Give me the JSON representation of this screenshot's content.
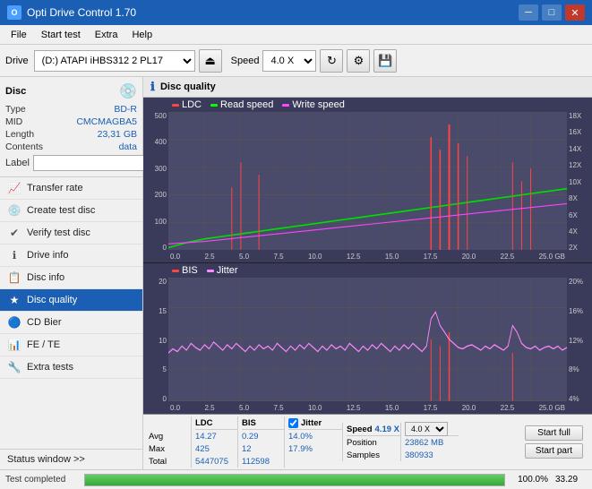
{
  "titlebar": {
    "title": "Opti Drive Control 1.70",
    "icon": "O",
    "min_label": "─",
    "max_label": "□",
    "close_label": "✕"
  },
  "menubar": {
    "items": [
      "File",
      "Start test",
      "Extra",
      "Help"
    ]
  },
  "toolbar": {
    "drive_label": "Drive",
    "drive_value": "(D:) ATAPI iHBS312  2 PL17",
    "speed_label": "Speed",
    "speed_value": "4.0 X"
  },
  "disc": {
    "title": "Disc",
    "type_label": "Type",
    "type_value": "BD-R",
    "mid_label": "MID",
    "mid_value": "CMCMAGBA5",
    "length_label": "Length",
    "length_value": "23,31 GB",
    "contents_label": "Contents",
    "contents_value": "data",
    "label_label": "Label",
    "label_placeholder": ""
  },
  "nav": {
    "items": [
      {
        "id": "transfer-rate",
        "label": "Transfer rate",
        "icon": "📈"
      },
      {
        "id": "create-test-disc",
        "label": "Create test disc",
        "icon": "💿"
      },
      {
        "id": "verify-test-disc",
        "label": "Verify test disc",
        "icon": "✔"
      },
      {
        "id": "drive-info",
        "label": "Drive info",
        "icon": "ℹ"
      },
      {
        "id": "disc-info",
        "label": "Disc info",
        "icon": "📋"
      },
      {
        "id": "disc-quality",
        "label": "Disc quality",
        "icon": "★",
        "active": true
      },
      {
        "id": "cd-bier",
        "label": "CD Bier",
        "icon": "🔵"
      },
      {
        "id": "fe-te",
        "label": "FE / TE",
        "icon": "📊"
      },
      {
        "id": "extra-tests",
        "label": "Extra tests",
        "icon": "🔧"
      }
    ],
    "status_window": "Status window >>"
  },
  "chart1": {
    "title": "Disc quality",
    "legend": [
      {
        "label": "LDC",
        "color": "#ff4444"
      },
      {
        "label": "Read speed",
        "color": "#00ff00"
      },
      {
        "label": "Write speed",
        "color": "#ff44ff"
      }
    ],
    "y_left": [
      "500",
      "400",
      "300",
      "200",
      "100",
      "0"
    ],
    "y_right": [
      "18X",
      "16X",
      "14X",
      "12X",
      "10X",
      "8X",
      "6X",
      "4X",
      "2X"
    ],
    "x_labels": [
      "0.0",
      "2.5",
      "5.0",
      "7.5",
      "10.0",
      "12.5",
      "15.0",
      "17.5",
      "20.0",
      "22.5",
      "25.0 GB"
    ]
  },
  "chart2": {
    "legend": [
      {
        "label": "BIS",
        "color": "#ff4444"
      },
      {
        "label": "Jitter",
        "color": "#ff88ff"
      }
    ],
    "y_left": [
      "20",
      "15",
      "10",
      "5",
      "0"
    ],
    "y_right": [
      "20%",
      "16%",
      "12%",
      "8%",
      "4%"
    ],
    "x_labels": [
      "0.0",
      "2.5",
      "5.0",
      "7.5",
      "10.0",
      "12.5",
      "15.0",
      "17.5",
      "20.0",
      "22.5",
      "25.0 GB"
    ]
  },
  "stats": {
    "headers": [
      "LDC",
      "BIS",
      "",
      "Jitter",
      "Speed",
      ""
    ],
    "avg_label": "Avg",
    "max_label": "Max",
    "total_label": "Total",
    "ldc_avg": "14.27",
    "ldc_max": "425",
    "ldc_total": "5447075",
    "bis_avg": "0.29",
    "bis_max": "12",
    "bis_total": "112598",
    "jitter_avg": "14.0%",
    "jitter_max": "17.9%",
    "speed_label": "Speed",
    "speed_value": "4.19 X",
    "speed_select": "4.0 X",
    "position_label": "Position",
    "position_value": "23862 MB",
    "samples_label": "Samples",
    "samples_value": "380933",
    "start_full_label": "Start full",
    "start_part_label": "Start part"
  },
  "bottom": {
    "status": "Test completed",
    "progress": 100,
    "progress_text": "100.0%",
    "right_value": "33.29"
  }
}
